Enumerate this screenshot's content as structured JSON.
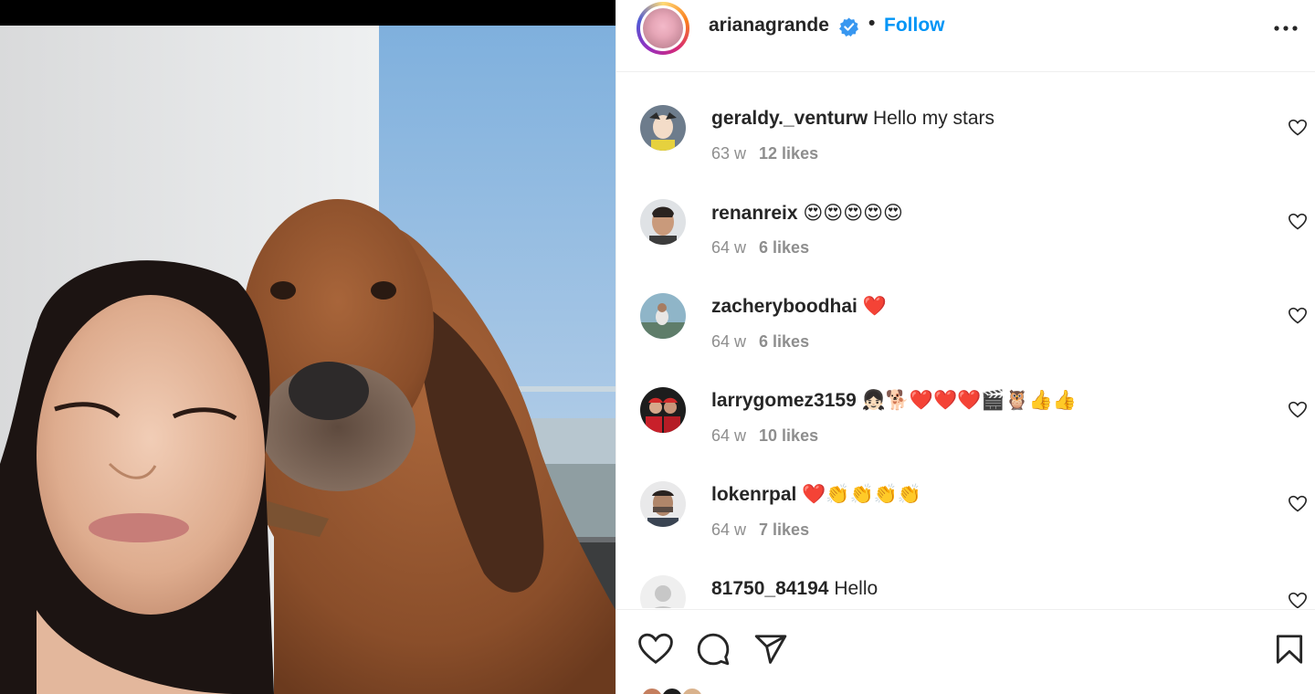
{
  "post": {
    "author": "arianagrande",
    "separator": "•",
    "follow_label": "Follow"
  },
  "comments": [
    {
      "user": "geraldy._venturw",
      "text": "Hello my stars",
      "age": "63 w",
      "likes": "12 likes"
    },
    {
      "user": "renanreix",
      "text": "😍😍😍😍😍",
      "age": "64 w",
      "likes": "6 likes"
    },
    {
      "user": "zacheryboodhai",
      "text": "❤️",
      "age": "64 w",
      "likes": "6 likes"
    },
    {
      "user": "larrygomez3159",
      "text": "👧🏻🐕❤️❤️❤️🎬🦉👍👍",
      "age": "64 w",
      "likes": "10 likes"
    },
    {
      "user": "lokenrpal",
      "text": "❤️👏👏👏👏",
      "age": "64 w",
      "likes": "7 likes"
    },
    {
      "user": "81750_84194",
      "text": "Hello",
      "age": "",
      "likes": ""
    }
  ],
  "icons": {
    "verified": "verified-badge-icon",
    "more": "more-options-icon",
    "heart": "heart-icon",
    "comment": "comment-icon",
    "share": "share-icon",
    "save": "bookmark-icon"
  },
  "colors": {
    "accent": "#0095f6",
    "text": "#262626",
    "muted": "#8e8e8e",
    "border": "#efefef"
  }
}
